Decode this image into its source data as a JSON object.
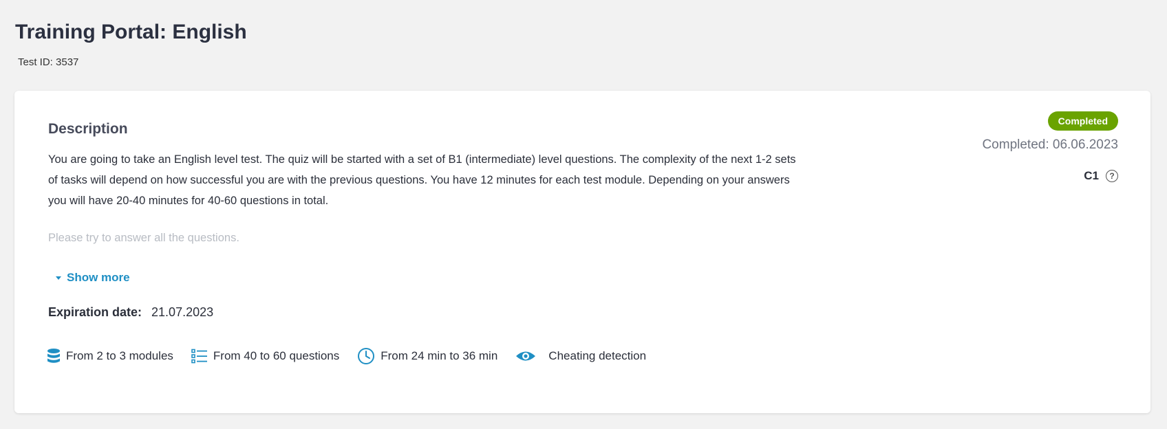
{
  "header": {
    "title": "Training Portal: English",
    "test_id": "Test ID: 3537"
  },
  "card": {
    "description_heading": "Description",
    "description_text": "You are going to take an English level test. The quiz will be started with a set of B1 (intermediate) level questions. The complexity of the next 1-2 sets of tasks will depend on how successful you are with the previous questions. You have 12 minutes for each test module. Depending on your answers you will have 20-40 minutes for 40-60 questions in total.",
    "description_faded": "Please try to answer all the questions.",
    "show_more_label": "Show more",
    "expiration_label": "Expiration date:",
    "expiration_value": "21.07.2023",
    "features": {
      "modules": "From 2 to 3 modules",
      "questions": "From 40 to 60 questions",
      "duration": "From 24 min to 36 min",
      "cheating": "Cheating detection"
    },
    "status": {
      "badge": "Completed",
      "completed_date": "Completed: 06.06.2023",
      "level": "C1",
      "help_glyph": "?"
    }
  },
  "colors": {
    "accent": "#1f8fc4",
    "success": "#6aa300",
    "background": "#f2f2f2"
  },
  "icons": [
    "database-icon",
    "list-icon",
    "clock-icon",
    "eye-icon",
    "help-icon",
    "caret-down-icon"
  ]
}
